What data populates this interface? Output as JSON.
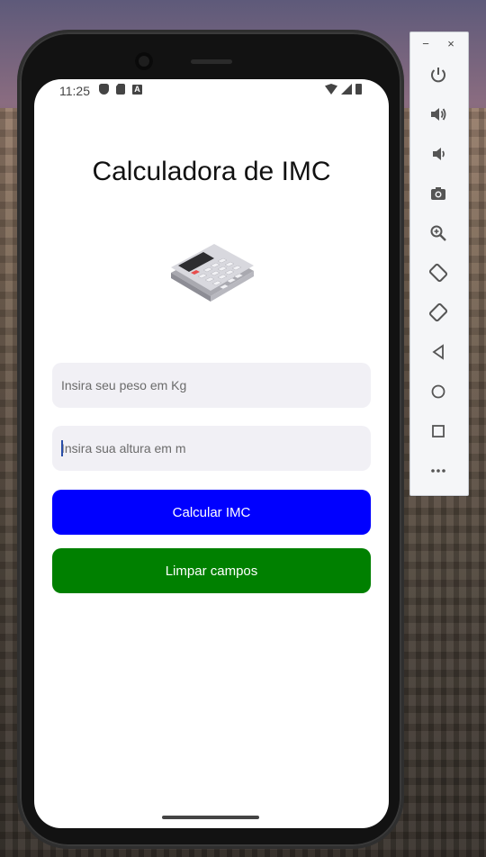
{
  "status_bar": {
    "time": "11:25"
  },
  "app": {
    "title": "Calculadora de IMC",
    "weight_placeholder": "Insira seu peso em Kg",
    "height_placeholder": "Insira sua altura em m",
    "calc_button_label": "Calcular IMC",
    "clear_button_label": "Limpar campos"
  },
  "colors": {
    "calc_button": "#0000ff",
    "clear_button": "#008000",
    "input_bg": "#f1f0f5"
  },
  "emulator_panel": {
    "window_controls": [
      "−",
      "×"
    ],
    "tools": [
      "power-icon",
      "volume-up-icon",
      "volume-down-icon",
      "camera-icon",
      "zoom-icon",
      "rotate-left-icon",
      "rotate-right-icon",
      "back-icon",
      "home-icon",
      "overview-icon",
      "more-icon"
    ]
  }
}
